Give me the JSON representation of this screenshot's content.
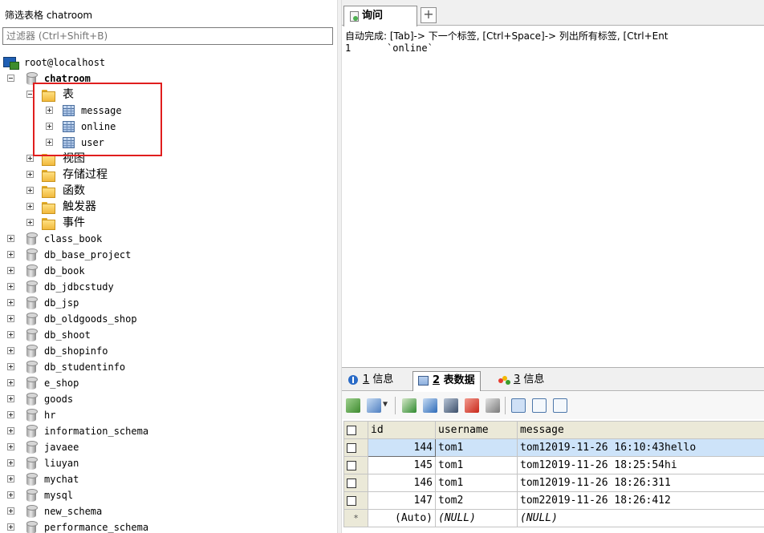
{
  "left_panel": {
    "filter_title": "筛选表格 chatroom",
    "filter_placeholder": "过滤器 (Ctrl+Shift+B)",
    "connection": "root@localhost",
    "current_db": "chatroom",
    "tables_folder": "表",
    "tables": [
      "message",
      "online",
      "user"
    ],
    "other_folders": [
      "视图",
      "存储过程",
      "函数",
      "触发器",
      "事件"
    ],
    "databases": [
      "class_book",
      "db_base_project",
      "db_book",
      "db_jdbcstudy",
      "db_jsp",
      "db_oldgoods_shop",
      "db_shoot",
      "db_shopinfo",
      "db_studentinfo",
      "e_shop",
      "goods",
      "hr",
      "information_schema",
      "javaee",
      "liuyan",
      "mychat",
      "mysql",
      "new_schema",
      "performance_schema"
    ]
  },
  "query_tab": {
    "tab_label": "询问",
    "add_tab_symbol": "+",
    "autocomplete_hint": "自动完成: [Tab]-> 下一个标签, [Ctrl+Space]-> 列出所有标签, [Ctrl+Ent",
    "line_number": "1",
    "query_text": "`online`"
  },
  "result_tabs": [
    {
      "num": "1",
      "label": "信息",
      "icon": "info-icon"
    },
    {
      "num": "2",
      "label": "表数据",
      "icon": "grid-icon"
    },
    {
      "num": "3",
      "label": "信息",
      "icon": "chart-icon"
    }
  ],
  "grid": {
    "columns": [
      "id",
      "username",
      "message"
    ],
    "rows": [
      {
        "id": "144",
        "username": "tom1",
        "message": "tom12019-11-26 16:10:43hello"
      },
      {
        "id": "145",
        "username": "tom1",
        "message": "tom12019-11-26 18:25:54hi"
      },
      {
        "id": "146",
        "username": "tom1",
        "message": "tom12019-11-26 18:26:311"
      },
      {
        "id": "147",
        "username": "tom2",
        "message": "tom22019-11-26 18:26:412"
      }
    ],
    "new_row": {
      "marker": "*",
      "id": "(Auto)",
      "username": "(NULL)",
      "message": "(NULL)"
    }
  },
  "colors": {
    "highlight_border": "#e01e1e",
    "selected_row": "#cde3f9",
    "header_bg": "#ebe9d8"
  }
}
